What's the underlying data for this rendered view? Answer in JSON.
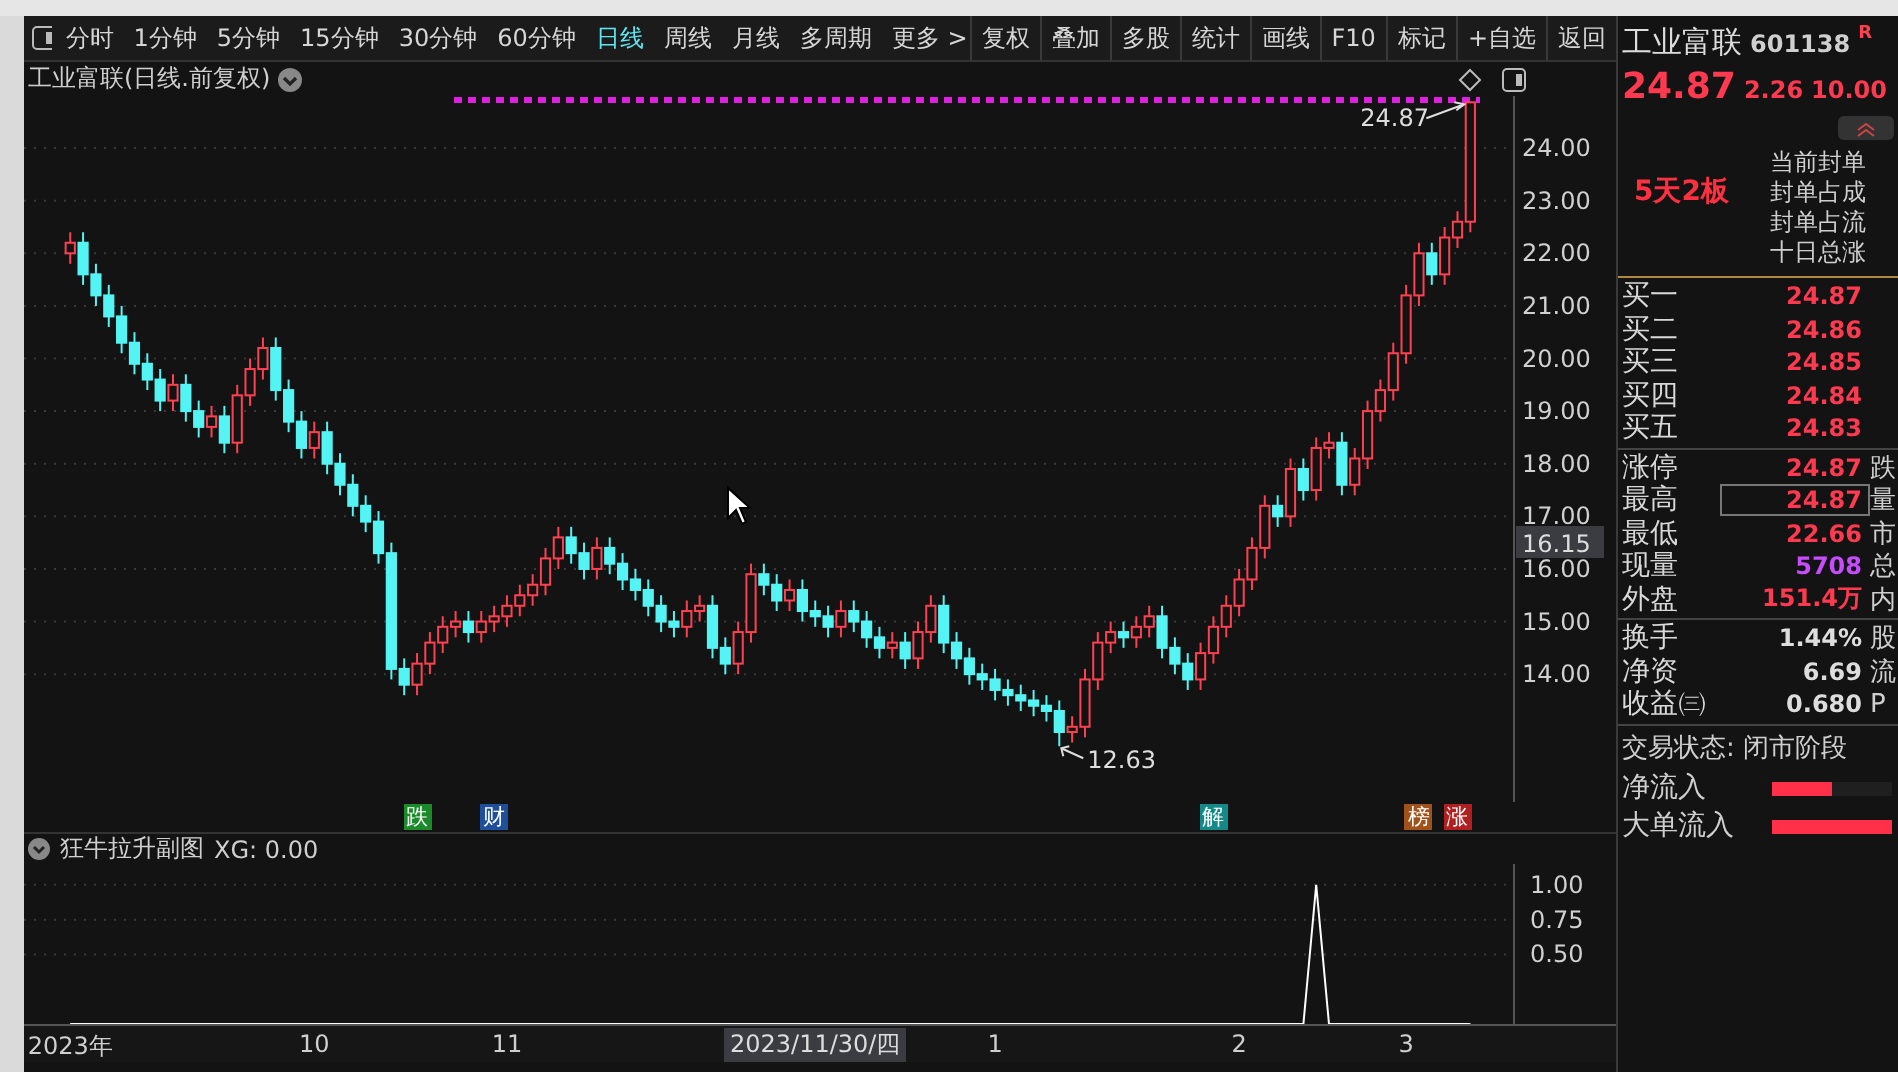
{
  "toolbar": {
    "periods": [
      {
        "label": "分时",
        "selected": false
      },
      {
        "label": "1分钟",
        "selected": false
      },
      {
        "label": "5分钟",
        "selected": false
      },
      {
        "label": "15分钟",
        "selected": false
      },
      {
        "label": "30分钟",
        "selected": false
      },
      {
        "label": "60分钟",
        "selected": false
      },
      {
        "label": "日线",
        "selected": true
      },
      {
        "label": "周线",
        "selected": false
      },
      {
        "label": "月线",
        "selected": false
      },
      {
        "label": "多周期",
        "selected": false
      },
      {
        "label": "更多 >",
        "selected": false
      }
    ],
    "buttons": [
      "复权",
      "叠加",
      "多股",
      "统计",
      "画线",
      "F10",
      "标记",
      "+自选",
      "返回"
    ]
  },
  "price_pane": {
    "title": "工业富联(日线.前复权)",
    "cursor_price": "16.15",
    "events": [
      {
        "text": "跌",
        "color": "#1a8a2a"
      },
      {
        "text": "财",
        "color": "#1e4f9a"
      },
      {
        "text": "解",
        "color": "#138a8a"
      },
      {
        "text": "榜",
        "color": "#a0521a"
      },
      {
        "text": "涨",
        "color": "#b02020"
      }
    ],
    "chart_data": {
      "type": "candlestick",
      "grid": true,
      "ylim": [
        11.57,
        24.99
      ],
      "yticks": [
        {
          "value": 14,
          "label": "14.00"
        },
        {
          "value": 15,
          "label": "15.00"
        },
        {
          "value": 16,
          "label": "16.00"
        },
        {
          "value": 17,
          "label": "17.00"
        },
        {
          "value": 18,
          "label": "18.00"
        },
        {
          "value": 19,
          "label": "19.00"
        },
        {
          "value": 20,
          "label": "20.00"
        },
        {
          "value": 21,
          "label": "21.00"
        },
        {
          "value": 22,
          "label": "22.00"
        },
        {
          "value": 23,
          "label": "23.00"
        },
        {
          "value": 24,
          "label": "24.00"
        }
      ],
      "categories": [
        null,
        null,
        null,
        null,
        null,
        null,
        null,
        null,
        null,
        null,
        null,
        null,
        null,
        null,
        null,
        null,
        null,
        null,
        null,
        null,
        null,
        null,
        null,
        null,
        null,
        null,
        null,
        null,
        null,
        null,
        null,
        null,
        null,
        null,
        null,
        null,
        null,
        null,
        null,
        null,
        null,
        null,
        null,
        null,
        null,
        null,
        null,
        null,
        null,
        null,
        null,
        null,
        null,
        null,
        null,
        null,
        null,
        null,
        null,
        null,
        null,
        null,
        null,
        null,
        null,
        null,
        null,
        null,
        null,
        null,
        null,
        null,
        null,
        null,
        null,
        null,
        null,
        null,
        null,
        null,
        null,
        null,
        null,
        null,
        null,
        null,
        null,
        null,
        null,
        null,
        null,
        null,
        null,
        null,
        null,
        null,
        null,
        null,
        null,
        null,
        null,
        null,
        null,
        null,
        null,
        null,
        null,
        null,
        null,
        null
      ],
      "ohlc": [
        [
          22.0,
          22.4,
          21.8,
          22.2
        ],
        [
          22.2,
          22.4,
          21.4,
          21.6
        ],
        [
          21.6,
          21.8,
          21.0,
          21.2
        ],
        [
          21.2,
          21.4,
          20.6,
          20.8
        ],
        [
          20.8,
          21.0,
          20.1,
          20.3
        ],
        [
          20.3,
          20.5,
          19.7,
          19.9
        ],
        [
          19.9,
          20.1,
          19.4,
          19.6
        ],
        [
          19.6,
          19.8,
          19.0,
          19.2
        ],
        [
          19.2,
          19.7,
          19.0,
          19.5
        ],
        [
          19.5,
          19.7,
          18.8,
          19.0
        ],
        [
          19.0,
          19.2,
          18.5,
          18.7
        ],
        [
          18.7,
          19.1,
          18.5,
          18.9
        ],
        [
          18.9,
          19.1,
          18.2,
          18.4
        ],
        [
          18.4,
          19.5,
          18.2,
          19.3
        ],
        [
          19.3,
          20.0,
          19.1,
          19.8
        ],
        [
          19.8,
          20.4,
          19.6,
          20.2
        ],
        [
          20.2,
          20.4,
          19.2,
          19.4
        ],
        [
          19.4,
          19.6,
          18.6,
          18.8
        ],
        [
          18.8,
          19.0,
          18.1,
          18.3
        ],
        [
          18.3,
          18.8,
          18.1,
          18.6
        ],
        [
          18.6,
          18.8,
          17.8,
          18.0
        ],
        [
          18.0,
          18.2,
          17.4,
          17.6
        ],
        [
          17.6,
          17.8,
          17.0,
          17.2
        ],
        [
          17.2,
          17.4,
          16.7,
          16.9
        ],
        [
          16.9,
          17.1,
          16.1,
          16.3
        ],
        [
          16.3,
          16.5,
          13.9,
          14.1
        ],
        [
          14.1,
          14.3,
          13.6,
          13.8
        ],
        [
          13.8,
          14.4,
          13.6,
          14.2
        ],
        [
          14.2,
          14.8,
          14.0,
          14.6
        ],
        [
          14.6,
          15.1,
          14.4,
          14.9
        ],
        [
          14.9,
          15.2,
          14.7,
          15.0
        ],
        [
          15.0,
          15.2,
          14.6,
          14.8
        ],
        [
          14.8,
          15.2,
          14.6,
          15.0
        ],
        [
          15.0,
          15.3,
          14.8,
          15.1
        ],
        [
          15.1,
          15.5,
          14.9,
          15.3
        ],
        [
          15.3,
          15.7,
          15.1,
          15.5
        ],
        [
          15.5,
          15.9,
          15.3,
          15.7
        ],
        [
          15.7,
          16.4,
          15.5,
          16.2
        ],
        [
          16.2,
          16.8,
          16.0,
          16.6
        ],
        [
          16.6,
          16.8,
          16.1,
          16.3
        ],
        [
          16.3,
          16.5,
          15.8,
          16.0
        ],
        [
          16.0,
          16.6,
          15.8,
          16.4
        ],
        [
          16.4,
          16.6,
          15.9,
          16.1
        ],
        [
          16.1,
          16.3,
          15.6,
          15.8
        ],
        [
          15.8,
          16.0,
          15.4,
          15.6
        ],
        [
          15.6,
          15.8,
          15.1,
          15.3
        ],
        [
          15.3,
          15.5,
          14.8,
          15.0
        ],
        [
          15.0,
          15.2,
          14.7,
          14.9
        ],
        [
          14.9,
          15.4,
          14.7,
          15.2
        ],
        [
          15.2,
          15.5,
          15.0,
          15.3
        ],
        [
          15.3,
          15.5,
          14.3,
          14.5
        ],
        [
          14.5,
          14.7,
          14.0,
          14.2
        ],
        [
          14.2,
          15.0,
          14.0,
          14.8
        ],
        [
          14.8,
          16.1,
          14.6,
          15.9
        ],
        [
          15.9,
          16.1,
          15.5,
          15.7
        ],
        [
          15.7,
          15.9,
          15.2,
          15.4
        ],
        [
          15.4,
          15.8,
          15.2,
          15.6
        ],
        [
          15.6,
          15.8,
          15.0,
          15.2
        ],
        [
          15.2,
          15.4,
          14.9,
          15.1
        ],
        [
          15.1,
          15.3,
          14.7,
          14.9
        ],
        [
          14.9,
          15.4,
          14.7,
          15.2
        ],
        [
          15.2,
          15.4,
          14.8,
          15.0
        ],
        [
          15.0,
          15.2,
          14.5,
          14.7
        ],
        [
          14.7,
          14.9,
          14.3,
          14.5
        ],
        [
          14.5,
          14.8,
          14.3,
          14.6
        ],
        [
          14.6,
          14.8,
          14.1,
          14.3
        ],
        [
          14.3,
          15.0,
          14.1,
          14.8
        ],
        [
          14.8,
          15.5,
          14.6,
          15.3
        ],
        [
          15.3,
          15.5,
          14.4,
          14.6
        ],
        [
          14.6,
          14.8,
          14.1,
          14.3
        ],
        [
          14.3,
          14.5,
          13.8,
          14.0
        ],
        [
          14.0,
          14.2,
          13.7,
          13.9
        ],
        [
          13.9,
          14.1,
          13.5,
          13.7
        ],
        [
          13.7,
          13.9,
          13.4,
          13.6
        ],
        [
          13.6,
          13.8,
          13.3,
          13.5
        ],
        [
          13.5,
          13.7,
          13.2,
          13.4
        ],
        [
          13.4,
          13.6,
          13.1,
          13.3
        ],
        [
          13.3,
          13.5,
          12.63,
          12.9
        ],
        [
          12.9,
          13.2,
          12.7,
          13.0
        ],
        [
          13.0,
          14.1,
          12.8,
          13.9
        ],
        [
          13.9,
          14.8,
          13.7,
          14.6
        ],
        [
          14.6,
          15.0,
          14.4,
          14.8
        ],
        [
          14.8,
          15.0,
          14.5,
          14.7
        ],
        [
          14.7,
          15.1,
          14.5,
          14.9
        ],
        [
          14.9,
          15.3,
          14.7,
          15.1
        ],
        [
          15.1,
          15.3,
          14.3,
          14.5
        ],
        [
          14.5,
          14.7,
          14.0,
          14.2
        ],
        [
          14.2,
          14.4,
          13.7,
          13.9
        ],
        [
          13.9,
          14.6,
          13.7,
          14.4
        ],
        [
          14.4,
          15.1,
          14.2,
          14.9
        ],
        [
          14.9,
          15.5,
          14.7,
          15.3
        ],
        [
          15.3,
          16.0,
          15.1,
          15.8
        ],
        [
          15.8,
          16.6,
          15.6,
          16.4
        ],
        [
          16.4,
          17.4,
          16.2,
          17.2
        ],
        [
          17.2,
          17.4,
          16.8,
          17.0
        ],
        [
          17.0,
          18.1,
          16.8,
          17.9
        ],
        [
          17.9,
          18.1,
          17.3,
          17.5
        ],
        [
          17.5,
          18.5,
          17.3,
          18.3
        ],
        [
          18.3,
          18.6,
          18.1,
          18.4
        ],
        [
          18.4,
          18.6,
          17.4,
          17.6
        ],
        [
          17.6,
          18.3,
          17.4,
          18.1
        ],
        [
          18.1,
          19.2,
          17.9,
          19.0
        ],
        [
          19.0,
          19.6,
          18.8,
          19.4
        ],
        [
          19.4,
          20.3,
          19.2,
          20.1
        ],
        [
          20.1,
          21.4,
          19.9,
          21.2
        ],
        [
          21.2,
          22.2,
          21.0,
          22.0
        ],
        [
          22.0,
          22.2,
          21.4,
          21.6
        ],
        [
          21.6,
          22.5,
          21.4,
          22.3
        ],
        [
          22.3,
          22.8,
          22.1,
          22.6
        ],
        [
          22.6,
          24.87,
          22.4,
          24.87
        ]
      ],
      "annotations": [
        "24.87",
        "12.63"
      ]
    }
  },
  "indicator_pane": {
    "title": "狂牛拉升副图",
    "reading": "XG: 0.00",
    "chart_data": {
      "type": "line",
      "grid": true,
      "ylim": [
        0,
        1.15
      ],
      "categories": [
        "2023年",
        null,
        null,
        null,
        null,
        null,
        null,
        null,
        null,
        null,
        null,
        null,
        null,
        null,
        null,
        null,
        null,
        null,
        null,
        "10",
        null,
        null,
        null,
        null,
        null,
        null,
        null,
        null,
        null,
        null,
        null,
        null,
        null,
        null,
        "11",
        null,
        null,
        null,
        null,
        null,
        null,
        null,
        null,
        null,
        null,
        null,
        null,
        null,
        null,
        null,
        null,
        null,
        null,
        null,
        null,
        null,
        null,
        null,
        null,
        null,
        null,
        null,
        null,
        null,
        null,
        null,
        null,
        null,
        null,
        null,
        null,
        null,
        "1",
        null,
        null,
        null,
        null,
        null,
        null,
        null,
        null,
        null,
        null,
        null,
        null,
        null,
        null,
        null,
        null,
        null,
        null,
        "2",
        null,
        null,
        null,
        null,
        null,
        null,
        null,
        null,
        null,
        null,
        null,
        null,
        "3",
        null,
        null,
        null,
        null,
        null
      ],
      "yticks": [
        {
          "value": 0.5,
          "label": "0.50"
        },
        {
          "value": 0.75,
          "label": "0.75"
        },
        {
          "value": 1,
          "label": "1.00"
        }
      ],
      "series": [
        {
          "color": "#ffffff",
          "values": [
            0,
            0,
            0,
            0,
            0,
            0,
            0,
            0,
            0,
            0,
            0,
            0,
            0,
            0,
            0,
            0,
            0,
            0,
            0,
            0,
            0,
            0,
            0,
            0,
            0,
            0,
            0,
            0,
            0,
            0,
            0,
            0,
            0,
            0,
            0,
            0,
            0,
            0,
            0,
            0,
            0,
            0,
            0,
            0,
            0,
            0,
            0,
            0,
            0,
            0,
            0,
            0,
            0,
            0,
            0,
            0,
            0,
            0,
            0,
            0,
            0,
            0,
            0,
            0,
            0,
            0,
            0,
            0,
            0,
            0,
            0,
            0,
            0,
            0,
            0,
            0,
            0,
            0,
            0,
            0,
            0,
            0,
            0,
            0,
            0,
            0,
            0,
            0,
            0,
            0,
            0,
            0,
            0,
            0,
            0,
            0,
            0,
            1,
            0,
            0,
            0,
            0,
            0,
            0,
            0,
            0,
            0,
            0,
            0,
            0
          ]
        }
      ]
    }
  },
  "cursor_date": "2023/11/30/四",
  "quote": {
    "name": "工业富联",
    "code": "601138",
    "badge": "R",
    "price": "24.87",
    "change": "2.26",
    "change_pct": "10.00"
  },
  "seal": {
    "label": "5天2板",
    "items": [
      "当前封单",
      "封单占成",
      "封单占流",
      "十日总涨"
    ]
  },
  "bids": [
    {
      "label": "买一",
      "price": "24.87"
    },
    {
      "label": "买二",
      "price": "24.86"
    },
    {
      "label": "买三",
      "price": "24.85"
    },
    {
      "label": "买四",
      "price": "24.84"
    },
    {
      "label": "买五",
      "price": "24.83"
    }
  ],
  "stats": [
    {
      "label": "涨停",
      "value": "24.87",
      "tail": "跌",
      "kind": "up",
      "highlighted": false
    },
    {
      "label": "最高",
      "value": "24.87",
      "tail": "量",
      "kind": "up",
      "highlighted": true
    },
    {
      "label": "最低",
      "value": "22.66",
      "tail": "市",
      "kind": "up",
      "highlighted": false
    },
    {
      "label": "现量",
      "value": "5708",
      "tail": "总",
      "kind": "volume",
      "highlighted": false
    },
    {
      "label": "外盘",
      "value": "151.4万",
      "tail": "内",
      "kind": "up",
      "highlighted": false
    }
  ],
  "fundamentals": [
    {
      "label": "换手",
      "value": "1.44%",
      "tail": "股"
    },
    {
      "label": "净资",
      "value": "6.69",
      "tail": "流"
    },
    {
      "label": "收益㈢",
      "value": "0.680",
      "tail": "P"
    }
  ],
  "trade_status": "交易状态: 闭市阶段",
  "flows": [
    {
      "label": "净流入",
      "level": 0.5
    },
    {
      "label": "大单流入",
      "level": 1
    }
  ]
}
